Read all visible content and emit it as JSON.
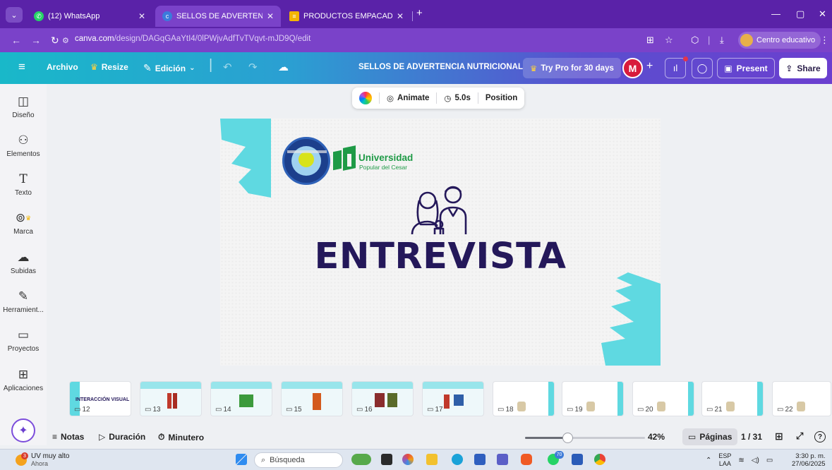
{
  "browser": {
    "tabs": [
      {
        "title": "(12) WhatsApp",
        "icon": "whatsapp-icon",
        "color": "#25d366",
        "badge": "12"
      },
      {
        "title": "SELLOS DE ADVERTENCIA NUTR",
        "icon": "canva-icon",
        "color": "#3b7bdc"
      },
      {
        "title": "PRODUCTOS EMPACADOS EN C",
        "icon": "slides-icon",
        "color": "#f4b400"
      }
    ],
    "new_tab": "+",
    "url_host": "canva.com",
    "url_path": "/design/DAGqGAaYtI4/0lPWjvAdfTvTVqvt-mJD9Q/edit",
    "profile_label": "Centro educativo"
  },
  "toolbar": {
    "menu_icon": "≡",
    "archivo": "Archivo",
    "resize": "Resize",
    "edicion": "Edición",
    "doc_title": "SELLOS DE ADVERTENCIA NUTRICIONAL",
    "try_pro": "Try Pro for 30 days",
    "avatar_letter": "M",
    "present": "Present",
    "share": "Share"
  },
  "sidebar": {
    "items": [
      {
        "label": "Diseño",
        "icon": "layout-icon",
        "glyph": "◫"
      },
      {
        "label": "Elementos",
        "icon": "shapes-icon",
        "glyph": "⚇"
      },
      {
        "label": "Texto",
        "icon": "text-icon",
        "glyph": "T"
      },
      {
        "label": "Marca",
        "icon": "brand-icon",
        "glyph": "⊚"
      },
      {
        "label": "Subidas",
        "icon": "upload-cloud-icon",
        "glyph": "☁"
      },
      {
        "label": "Herramient...",
        "icon": "pen-tool-icon",
        "glyph": "✎"
      },
      {
        "label": "Proyectos",
        "icon": "folder-icon",
        "glyph": "▭"
      },
      {
        "label": "Aplicaciones",
        "icon": "apps-icon",
        "glyph": "⊞"
      }
    ]
  },
  "context_toolbar": {
    "animate": "Animate",
    "duration": "5.0s",
    "position": "Position"
  },
  "slide": {
    "title": "ENTREVISTA",
    "university_name": "Universidad",
    "university_sub": "Popular del Cesar",
    "accent_color": "#5fd9e1",
    "title_color": "#24185a"
  },
  "pages": {
    "thumbs": [
      {
        "num": "12",
        "title": "INTERACCIÓN VISUAL"
      },
      {
        "num": "13"
      },
      {
        "num": "14"
      },
      {
        "num": "15"
      },
      {
        "num": "16"
      },
      {
        "num": "17"
      },
      {
        "num": "18"
      },
      {
        "num": "19"
      },
      {
        "num": "20"
      },
      {
        "num": "21"
      },
      {
        "num": "22"
      }
    ]
  },
  "bottombar": {
    "notas": "Notas",
    "duracion": "Duración",
    "minutero": "Minutero",
    "zoom": "42%",
    "zoom_fraction": 0.35,
    "paginas": "Páginas",
    "page_counter": "1 / 31",
    "help": "?"
  },
  "taskbar": {
    "weather_line1": "UV muy alto",
    "weather_line2": "Ahora",
    "weather_badge": "3",
    "search": "Búsqueda",
    "lang1": "ESP",
    "lang2": "LAA",
    "time": "3:30 p. m.",
    "date": "27/06/2025",
    "chrome_badge": "70"
  }
}
